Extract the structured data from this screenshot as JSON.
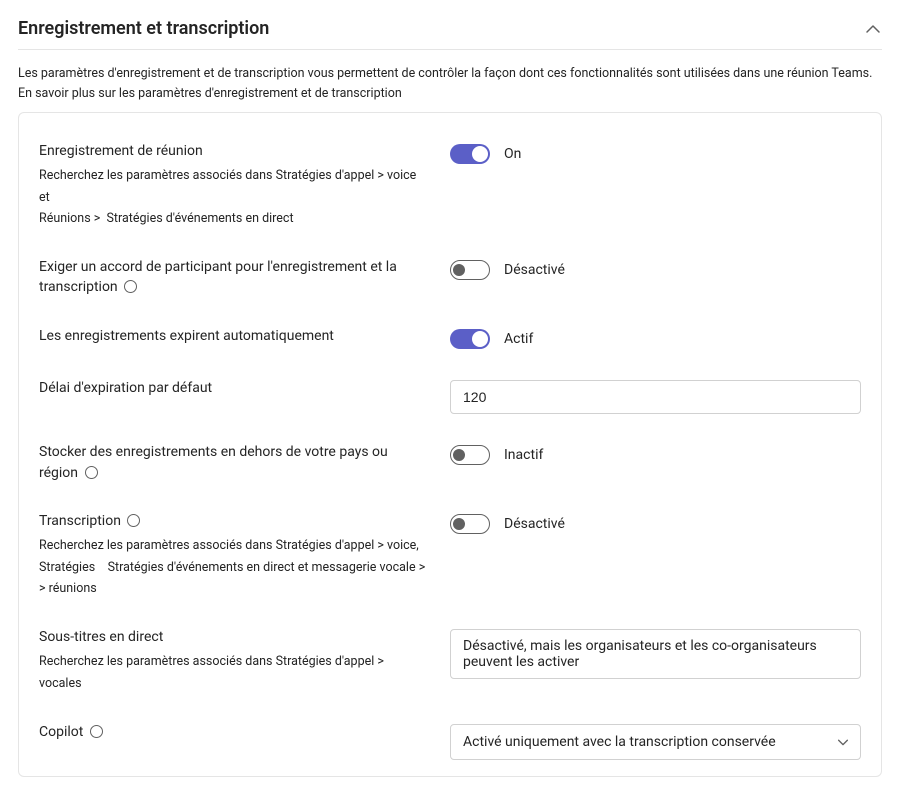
{
  "section": {
    "title": "Enregistrement et transcription",
    "intro_prefix": "Les paramètres d'enregistrement et de transcription vous permettent de contrôler la façon dont ces fonctionnalités sont utilisées dans une réunion Teams. En savoir plus sur ",
    "intro_link": "les paramètres d'enregistrement et de transcription"
  },
  "settings": {
    "meeting_recording": {
      "title": "Enregistrement de réunion",
      "hint_a": "Recherchez les paramètres associés dans Stratégies d'appel > voice et",
      "hint_b": "Réunions >",
      "hint_c": "Stratégies d'événements en direct",
      "state_label": "On",
      "on": true
    },
    "require_consent": {
      "title": "Exiger un accord de participant pour l'enregistrement et la transcription",
      "state_label": "Désactivé",
      "on": false
    },
    "auto_expire": {
      "title": "Les enregistrements expirent automatiquement",
      "state_label": "Actif",
      "on": true
    },
    "default_expiry": {
      "title": "Délai d'expiration par défaut",
      "value": "120"
    },
    "store_outside": {
      "title": "Stocker des enregistrements en dehors de votre pays ou région",
      "state_label": "Inactif",
      "on": false
    },
    "transcription": {
      "title": "Transcription",
      "hint_a": "Recherchez les paramètres associés dans Stratégies d'appel > voice,",
      "hint_b": "Stratégies",
      "hint_c": "Stratégies d'événements en direct et messagerie vocale >",
      "hint_d": "> réunions",
      "state_label": "Désactivé",
      "on": false
    },
    "live_captions": {
      "title": "Sous-titres en direct",
      "hint": "Recherchez les paramètres associés dans Stratégies d'appel > vocales",
      "value": "Désactivé, mais les organisateurs et les co-organisateurs peuvent les activer"
    },
    "copilot": {
      "title": "Copilot",
      "value": "Activé uniquement avec la transcription conservée"
    }
  }
}
